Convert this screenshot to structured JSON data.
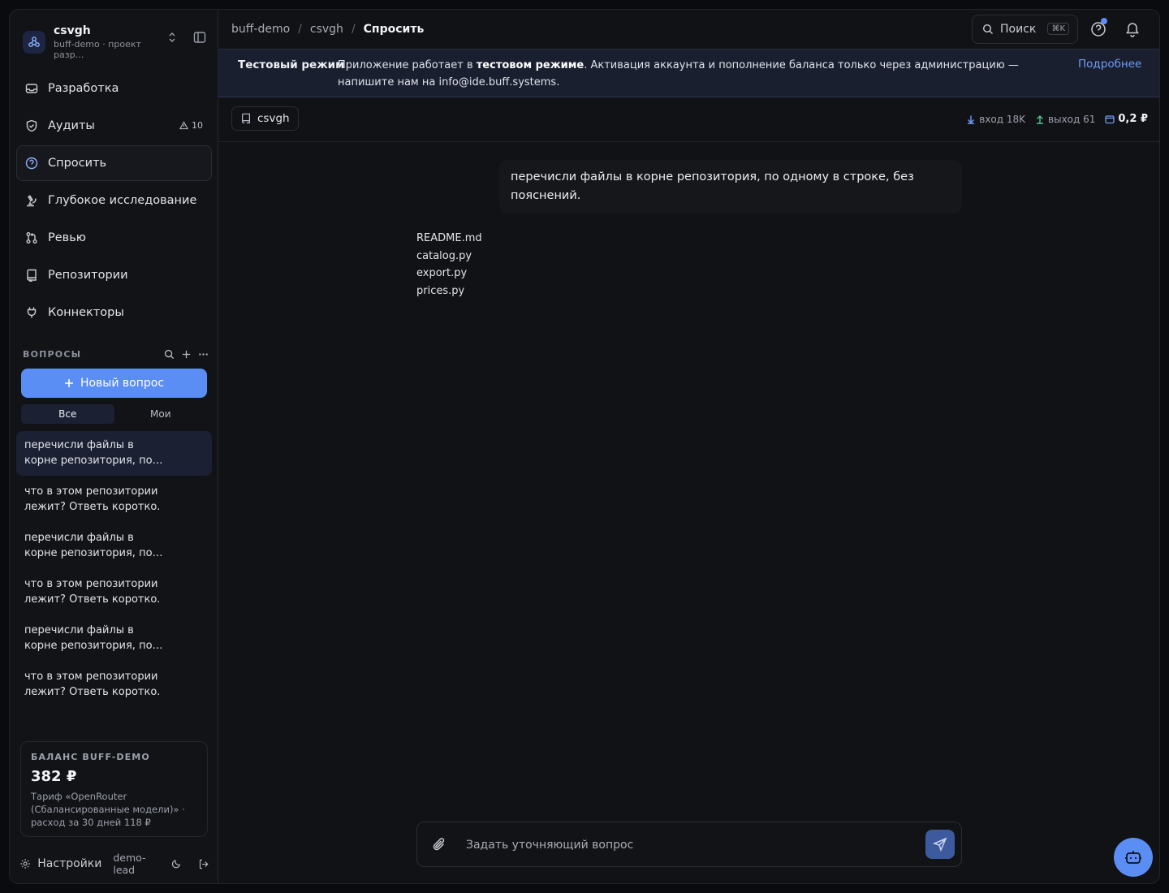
{
  "workspace": {
    "name": "csvgh",
    "subtitle": "buff-demo · проект разр…"
  },
  "nav": [
    {
      "label": "Разработка",
      "icon": "inbox-icon"
    },
    {
      "label": "Аудиты",
      "icon": "shield-icon",
      "badge": "10"
    },
    {
      "label": "Спросить",
      "icon": "help-circle-icon",
      "active": true
    },
    {
      "label": "Глубокое исследование",
      "icon": "microscope-icon"
    },
    {
      "label": "Ревью",
      "icon": "git-pull-request-icon"
    },
    {
      "label": "Репозитории",
      "icon": "repo-icon"
    },
    {
      "label": "Коннекторы",
      "icon": "plug-icon"
    }
  ],
  "questions": {
    "title": "ВОПРОСЫ",
    "new_button": "Новый вопрос",
    "filters": [
      "Все",
      "Мои"
    ],
    "items": [
      "перечисли файлы в корне репозитория, по одному в строке, без пояснений.",
      "что в этом репозитории лежит? Ответь коротко.",
      "перечисли файлы в корне репозитория, по одному в строке, без пояснений.",
      "что в этом репозитории лежит? Ответь коротко.",
      "перечисли файлы в корне репозитория, по одному в строке, без пояснений.",
      "что в этом репозитории лежит? Ответь коротко."
    ]
  },
  "balance": {
    "title": "БАЛАНС BUFF-DEMO",
    "value": "382 ₽",
    "description": "Тариф «OpenRouter (Сбалансированные модели)» · расход за 30 дней 118 ₽"
  },
  "footer": {
    "settings": "Настройки",
    "user": "demo-lead"
  },
  "breadcrumbs": [
    "buff-demo",
    "csvgh",
    "Спросить"
  ],
  "search": {
    "label": "Поиск",
    "shortcut": "⌘K"
  },
  "banner": {
    "label": "Тестовый режим",
    "text_before": "Приложение работает в ",
    "text_bold": "тестовом режиме",
    "text_after": ". Активация аккаунта и пополнение баланса только через администрацию — напишите нам на info@ide.buff.systems.",
    "link": "Подробнее"
  },
  "context": {
    "repo": "csvgh",
    "tokens_in": "вход 18K",
    "tokens_out": "выход 61",
    "cost": "0,2 ₽"
  },
  "chat": {
    "user_message": "перечисли файлы в корне репозитория, по одному в строке, без пояснений.",
    "answer_lines": [
      "README.md",
      "catalog.py",
      "export.py",
      "prices.py"
    ]
  },
  "composer": {
    "placeholder": "Задать уточняющий вопрос"
  },
  "colors": {
    "accent": "#5b8ef5",
    "banner_bg": "#1a1f30",
    "link": "#6f9cf7"
  }
}
